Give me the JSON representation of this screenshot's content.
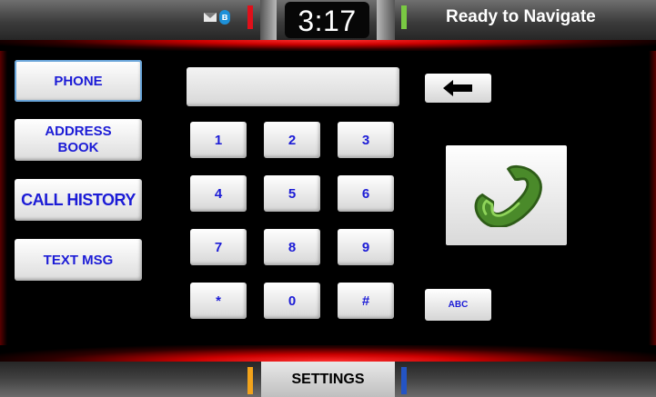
{
  "status_bar": {
    "time": "3:17",
    "status": "Ready to Navigate",
    "bluetooth_glyph": "ʙ",
    "icons": [
      "envelope-icon",
      "bluetooth-icon"
    ]
  },
  "nav": {
    "phone": "PHONE",
    "address_book": "ADDRESS\nBOOK",
    "call_history": "CALL HISTORY",
    "text_msg": "TEXT MSG"
  },
  "dialer": {
    "number": "",
    "keys": [
      "1",
      "2",
      "3",
      "4",
      "5",
      "6",
      "7",
      "8",
      "9",
      "*",
      "0",
      "#"
    ],
    "abc": "ABC",
    "backspace_icon": "arrow-left-icon",
    "call_icon": "phone-handset-icon"
  },
  "bottom_bar": {
    "settings": "SETTINGS"
  },
  "colors": {
    "accent_red": "#e0101a",
    "accent_green": "#7ac943",
    "accent_orange": "#f2a31b",
    "accent_blue": "#2454c4",
    "button_text": "#1c1cd6"
  }
}
